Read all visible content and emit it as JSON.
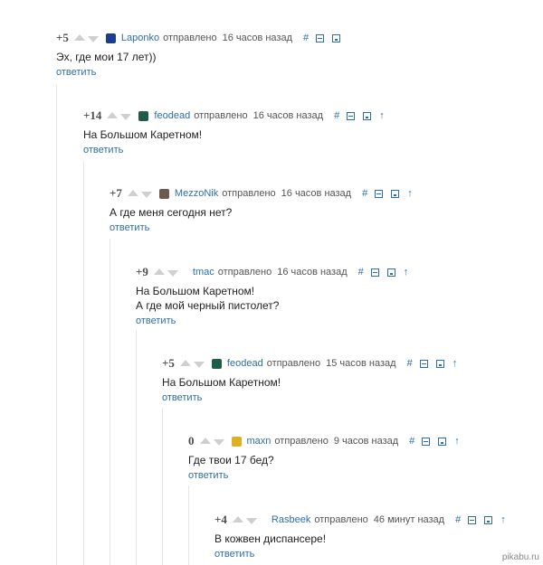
{
  "comments": [
    {
      "rating": "+5",
      "author": "Laponko",
      "posted": "отправлено",
      "age": "16 часов назад",
      "lines": [
        "Эх, где мои 17 лет))"
      ],
      "reply": "ответить",
      "avatar_color": "#1c3c8c",
      "has_parent_link": false
    },
    {
      "rating": "+14",
      "author": "feodead",
      "posted": "отправлено",
      "age": "16 часов назад",
      "lines": [
        "На Большом Каретном!"
      ],
      "reply": "ответить",
      "avatar_color": "#1f5d4a",
      "has_parent_link": true
    },
    {
      "rating": "+7",
      "author": "MezzoNik",
      "posted": "отправлено",
      "age": "16 часов назад",
      "lines": [
        "А где меня сегодня нет?"
      ],
      "reply": "ответить",
      "avatar_color": "#6b5b4f",
      "has_parent_link": true
    },
    {
      "rating": "+9",
      "author": "tmac",
      "posted": "отправлено",
      "age": "16 часов назад",
      "lines": [
        "На Большом Каретном!",
        "А где мой черный пистолет?"
      ],
      "reply": "ответить",
      "avatar_color": "",
      "has_parent_link": true
    },
    {
      "rating": "+5",
      "author": "feodead",
      "posted": "отправлено",
      "age": "15 часов назад",
      "lines": [
        "На Большом Каретном!"
      ],
      "reply": "ответить",
      "avatar_color": "#1f5d4a",
      "has_parent_link": true
    },
    {
      "rating": "0",
      "author": "maxn",
      "posted": "отправлено",
      "age": "9 часов назад",
      "lines": [
        "Где твои 17 бед?"
      ],
      "reply": "ответить",
      "avatar_color": "#e0b020",
      "has_parent_link": true
    },
    {
      "rating": "+4",
      "author": "Rasbeek",
      "posted": "отправлено",
      "age": "46 минут назад",
      "lines": [
        "В кожвен диспансере!"
      ],
      "reply": "ответить",
      "avatar_color": "",
      "has_parent_link": true
    }
  ],
  "icons": {
    "link": "#",
    "collapse": "collapse-icon",
    "save": "save-icon",
    "parent": "↑"
  },
  "colors": {
    "link": "#2c6ea8",
    "vote_arrow": "#cfcfcf",
    "thread_line": "#e6e6e6"
  },
  "watermark": "pikabu.ru"
}
